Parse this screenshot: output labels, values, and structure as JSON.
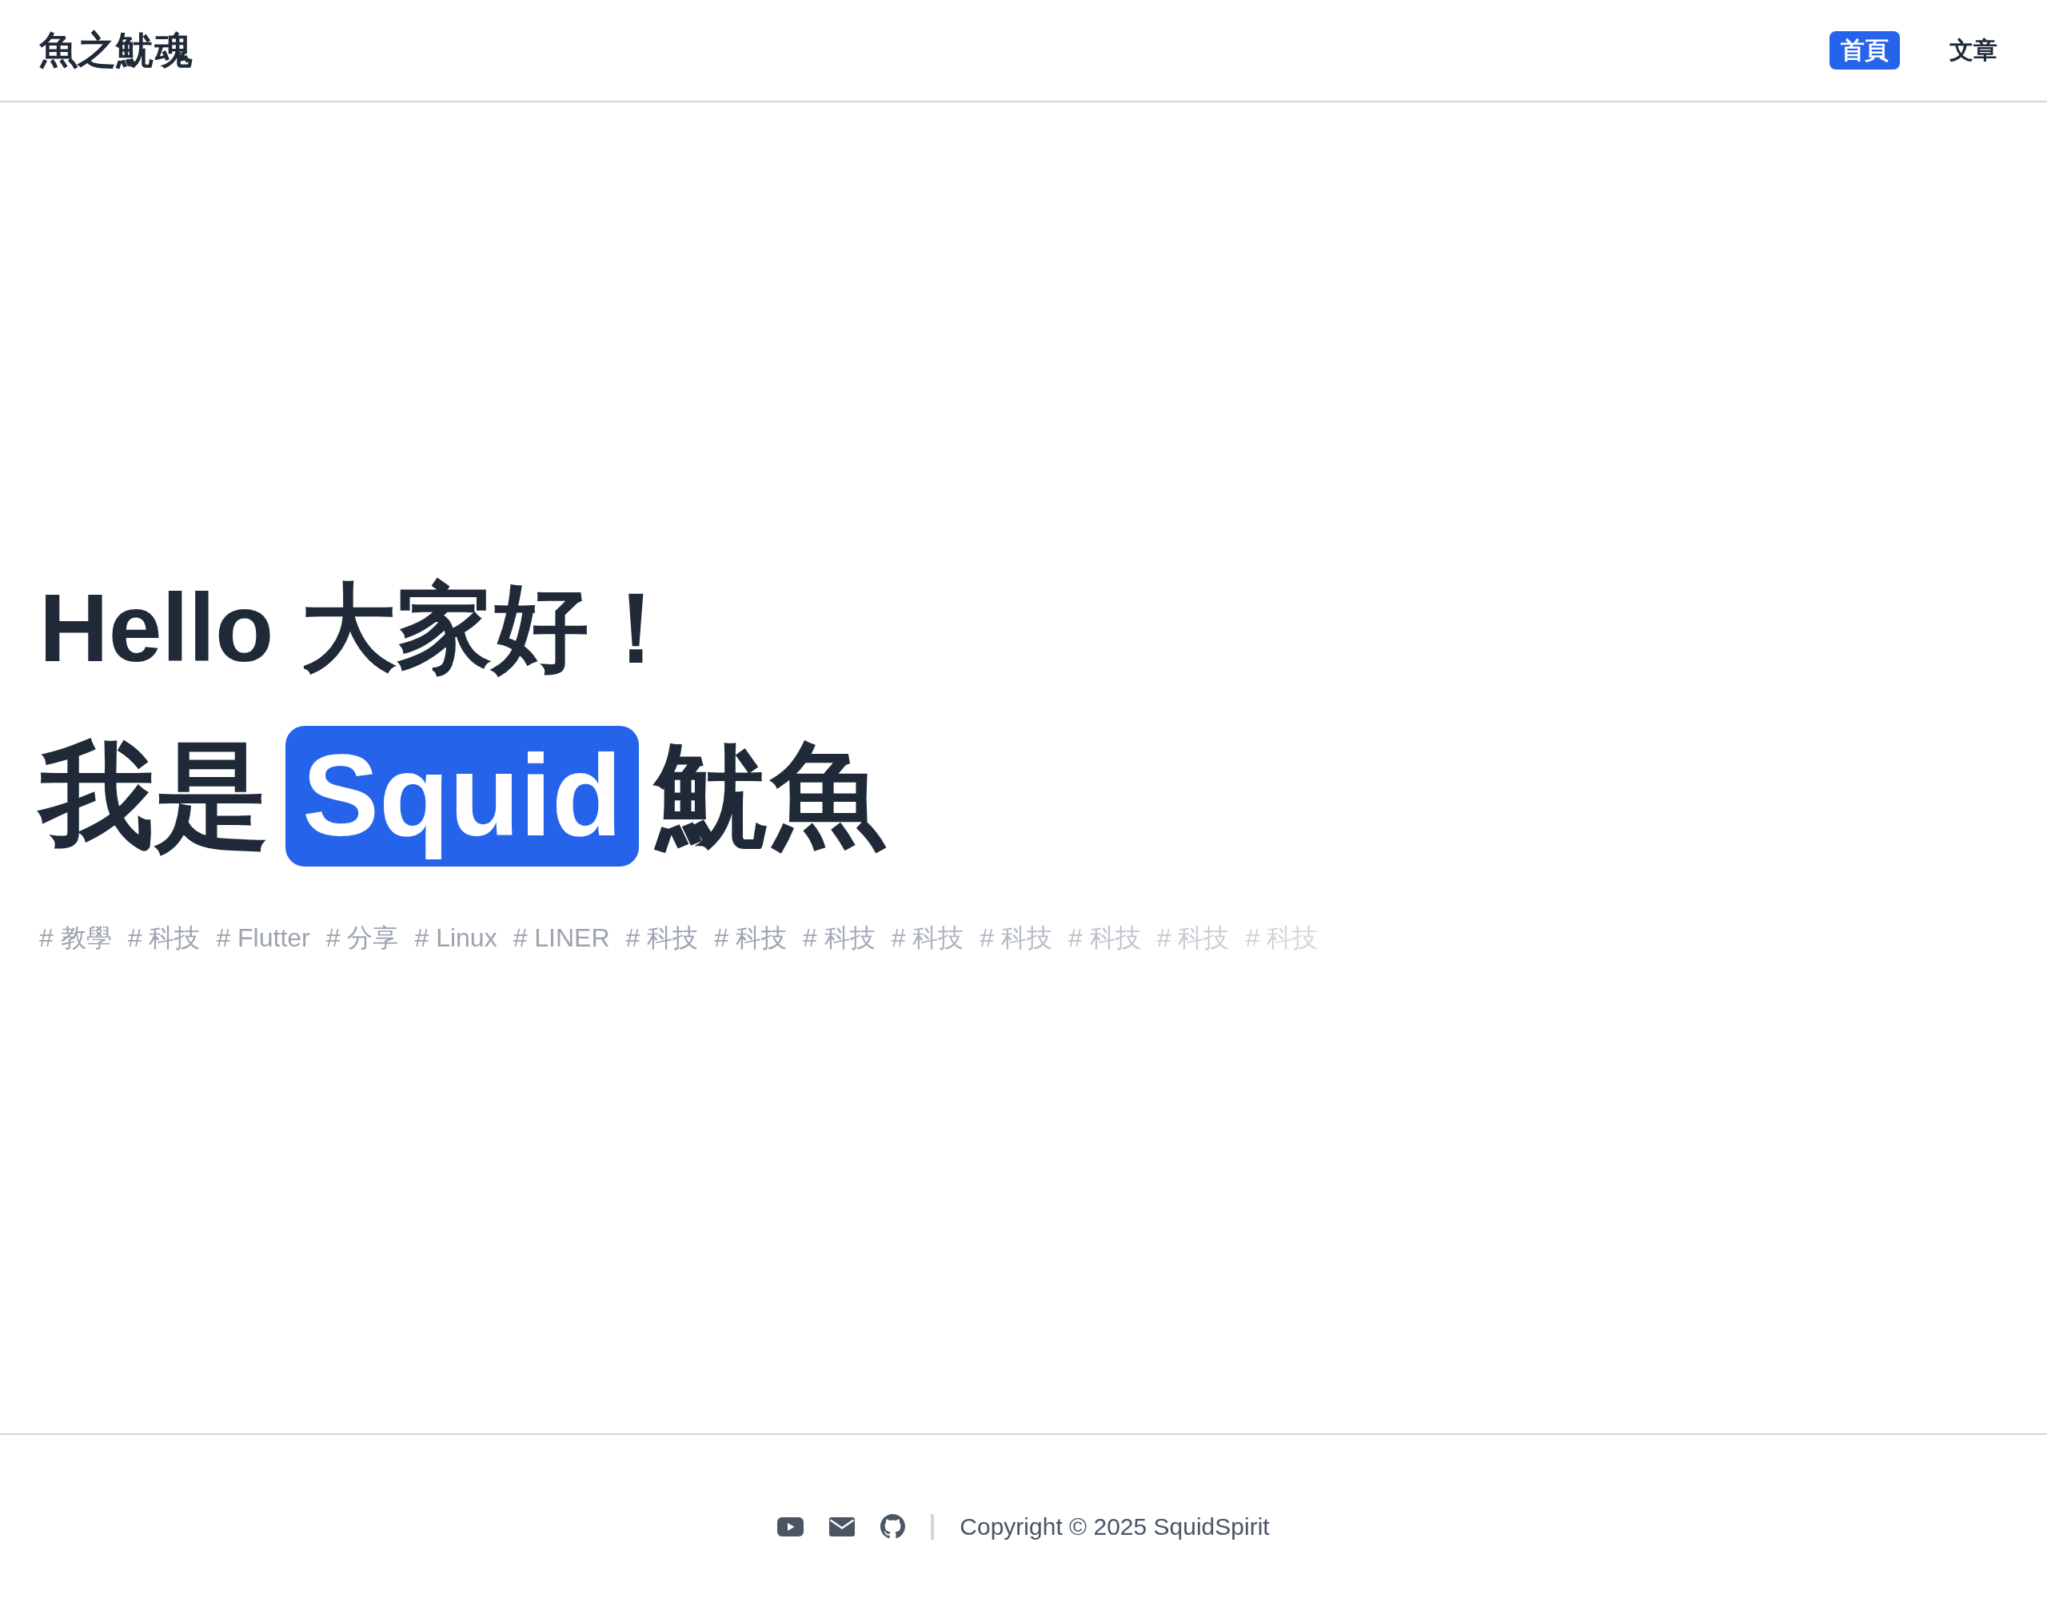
{
  "header": {
    "logo": "魚之魷魂",
    "nav": [
      {
        "label": "首頁",
        "selected": true
      },
      {
        "label": "文章",
        "selected": false
      }
    ]
  },
  "hero": {
    "greeting": "Hello 大家好！",
    "intro": [
      {
        "text": "我是",
        "highlight": false
      },
      {
        "text": "Squid",
        "highlight": true
      },
      {
        "text": "魷魚",
        "highlight": false
      }
    ],
    "tags": [
      "# 教學",
      "# 科技",
      "# Flutter",
      "# 分享",
      "# Linux",
      "# LINER",
      "# 科技",
      "# 科技",
      "# 科技",
      "# 科技",
      "# 科技",
      "# 科技",
      "# 科技",
      "# 科技"
    ]
  },
  "footer": {
    "links": [
      {
        "kind": "youtube"
      },
      {
        "kind": "email"
      },
      {
        "kind": "github"
      }
    ],
    "copyright": "Copyright © 2025 SquidSpirit"
  }
}
